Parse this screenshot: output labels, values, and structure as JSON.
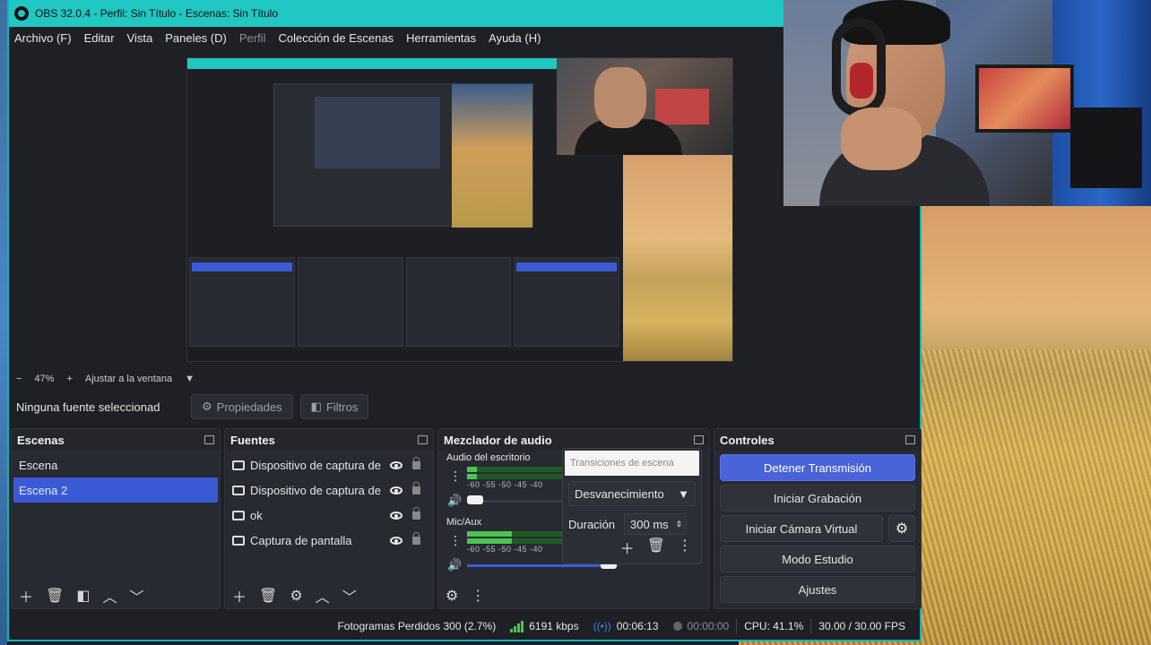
{
  "window": {
    "title": "OBS 32.0.4 - Perfil: Sin Título - Escenas: Sin Título"
  },
  "menu": {
    "items": [
      "Archivo (F)",
      "Editar",
      "Vista",
      "Paneles (D)",
      "Perfil",
      "Colección de Escenas",
      "Herramientas",
      "Ayuda (H)"
    ]
  },
  "preview": {
    "zoom_minus": "−",
    "zoom_level": "47%",
    "zoom_plus": "+",
    "fit_label": "Ajustar a la ventana"
  },
  "source_toolbar": {
    "no_selection": "Ninguna fuente seleccionad",
    "properties": "Propiedades",
    "filters": "Filtros"
  },
  "scenes": {
    "title": "Escenas",
    "items": [
      "Escena",
      "Escena 2"
    ],
    "selected_index": 1
  },
  "sources": {
    "title": "Fuentes",
    "items": [
      {
        "label": "Dispositivo de captura de v",
        "icon": "camera-icon"
      },
      {
        "label": "Dispositivo de captura de v",
        "icon": "camera-icon"
      },
      {
        "label": "ok",
        "icon": "monitor-icon"
      },
      {
        "label": "Captura de pantalla",
        "icon": "monitor-icon"
      }
    ]
  },
  "mixer": {
    "title": "Mezclador de audio",
    "channels": [
      {
        "name": "Audio del escritorio",
        "level": 0.1,
        "volume": 0.0,
        "ticks": "-60  -55  -50  -45  -40"
      },
      {
        "name": "Mic/Aux",
        "level": 0.45,
        "volume": 0.98,
        "ticks": "-60  -55  -50  -45  -40"
      }
    ]
  },
  "transitions": {
    "title": "Transiciones de escena",
    "selected": "Desvanecimiento",
    "duration_label": "Duración",
    "duration_value": "300 ms"
  },
  "controls": {
    "title": "Controles",
    "stop_stream": "Detener Transmisión",
    "start_recording": "Iniciar Grabación",
    "start_virtual_cam": "Iniciar Cámara Virtual",
    "studio_mode": "Modo Estudio",
    "settings": "Ajustes"
  },
  "status": {
    "dropped_frames": "Fotogramas Perdidos 300 (2.7%)",
    "bitrate": "6191 kbps",
    "stream_time": "00:06:13",
    "record_time": "00:00:00",
    "cpu": "CPU: 41.1%",
    "fps": "30.00 / 30.00 FPS"
  },
  "colors": {
    "titlebar": "#20c7c3",
    "accent": "#3b5bd6",
    "meter_green": "#4ac551"
  }
}
